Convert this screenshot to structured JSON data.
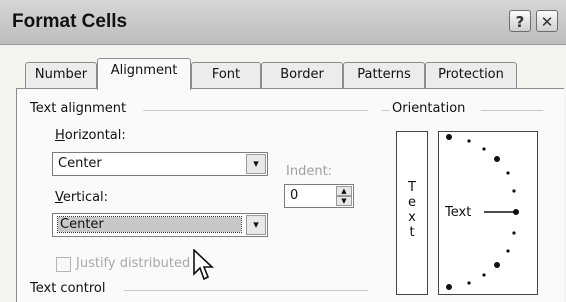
{
  "window": {
    "title": "Format Cells",
    "help_label": "?",
    "close_label": "✕"
  },
  "tabs": [
    {
      "label": "Number"
    },
    {
      "label": "Alignment"
    },
    {
      "label": "Font"
    },
    {
      "label": "Border"
    },
    {
      "label": "Patterns"
    },
    {
      "label": "Protection"
    }
  ],
  "text_alignment": {
    "group_label": "Text alignment",
    "horizontal_label_ul": "H",
    "horizontal_label_rest": "orizontal:",
    "horizontal_value": "Center",
    "vertical_label_ul": "V",
    "vertical_label_rest": "ertical:",
    "vertical_value": "Center",
    "indent_label": "Indent:",
    "indent_value": "0",
    "justify_label": "Justify distributed"
  },
  "text_control": {
    "group_label": "Text control"
  },
  "orientation": {
    "group_label": "Orientation",
    "vertical_letters": [
      "T",
      "e",
      "x",
      "t"
    ],
    "dial_label": "Text"
  },
  "icons": {
    "dropdown": "▾",
    "spin_up": "▲",
    "spin_down": "▼"
  }
}
